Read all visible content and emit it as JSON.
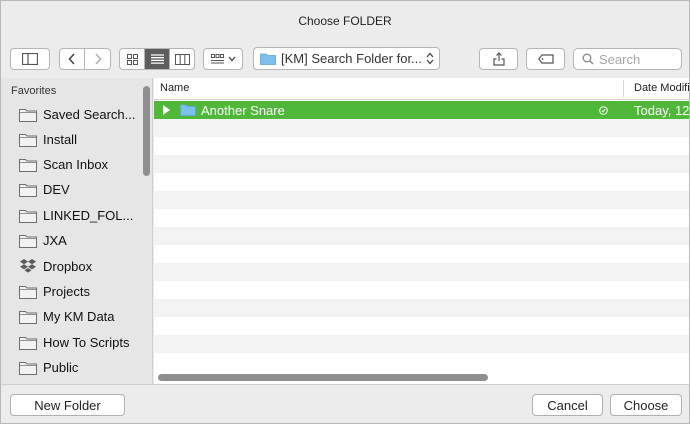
{
  "window": {
    "title": "Choose FOLDER"
  },
  "toolbar": {
    "path": "[KM] Search Folder for...",
    "search_placeholder": "Search"
  },
  "sidebar": {
    "section": "Favorites",
    "items": [
      {
        "label": "Saved Search...",
        "icon": "folder-icon"
      },
      {
        "label": "Install",
        "icon": "folder-icon"
      },
      {
        "label": "Scan Inbox",
        "icon": "folder-icon"
      },
      {
        "label": "DEV",
        "icon": "folder-icon"
      },
      {
        "label": "LINKED_FOL...",
        "icon": "folder-icon"
      },
      {
        "label": "JXA",
        "icon": "folder-icon"
      },
      {
        "label": "Dropbox",
        "icon": "dropbox-icon"
      },
      {
        "label": "Projects",
        "icon": "folder-icon"
      },
      {
        "label": "My KM Data",
        "icon": "folder-icon"
      },
      {
        "label": "How To Scripts",
        "icon": "folder-icon"
      },
      {
        "label": "Public",
        "icon": "folder-icon"
      }
    ]
  },
  "filelist": {
    "columns": [
      "Name",
      "Date Modifi"
    ],
    "rows": [
      {
        "name": "Another Snare",
        "date": "Today, 12:",
        "selected": true
      }
    ]
  },
  "buttons": {
    "new_folder": "New Folder",
    "cancel": "Cancel",
    "choose": "Choose"
  },
  "colors": {
    "selection": "#4fb838",
    "folder_blue": "#7cc0ee"
  }
}
